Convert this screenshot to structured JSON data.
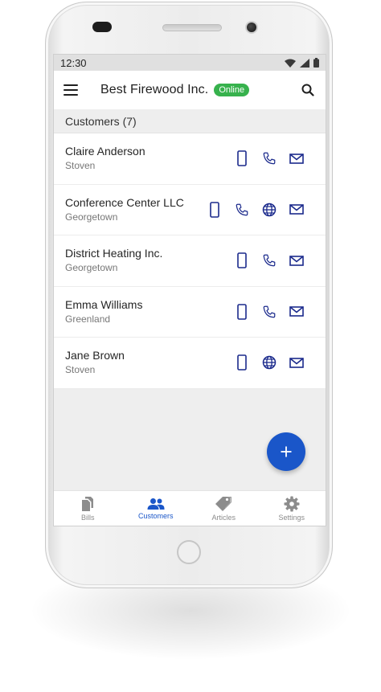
{
  "status": {
    "time": "12:30"
  },
  "appbar": {
    "title": "Best Firewood Inc.",
    "badge": "Online"
  },
  "section": {
    "title": "Customers (7)"
  },
  "customers": [
    {
      "name": "Claire Anderson",
      "city": "Stoven"
    },
    {
      "name": "Conference Center LLC",
      "city": "Georgetown"
    },
    {
      "name": "District Heating Inc.",
      "city": "Georgetown"
    },
    {
      "name": "Emma Williams",
      "city": "Greenland"
    },
    {
      "name": "Jane Brown",
      "city": "Stoven"
    }
  ],
  "nav": {
    "bills": "Bills",
    "customers": "Customers",
    "articles": "Articles",
    "settings": "Settings"
  },
  "colors": {
    "accent": "#1a56c9",
    "online": "#37b24d",
    "icon": "#1b2a8c"
  }
}
